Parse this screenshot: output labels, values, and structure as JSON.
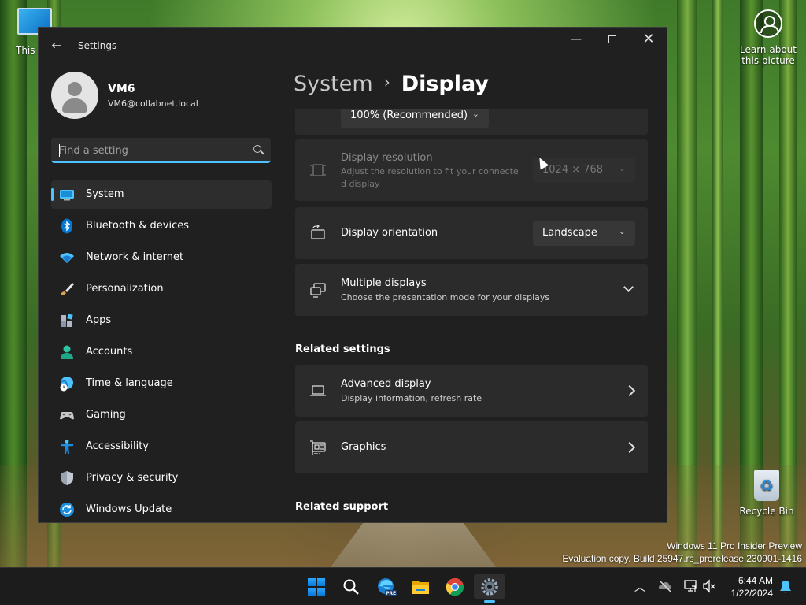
{
  "desktop": {
    "this_pc_label": "This PC",
    "learn_label": "Learn about this picture",
    "recycle_label": "Recycle Bin",
    "watermark_line1": "Windows 11 Pro Insider Preview",
    "watermark_line2": "Evaluation copy. Build 25947.rs_prerelease.230901-1416"
  },
  "window": {
    "title": "Settings",
    "back_glyph": "←",
    "min_glyph": "—",
    "close_glyph": "✕"
  },
  "profile": {
    "name": "VM6",
    "email": "VM6@collabnet.local"
  },
  "search": {
    "placeholder": "Find a setting",
    "value": ""
  },
  "nav": {
    "items": [
      {
        "label": "System",
        "icon": "monitor-icon",
        "active": true
      },
      {
        "label": "Bluetooth & devices",
        "icon": "bluetooth-icon"
      },
      {
        "label": "Network & internet",
        "icon": "wifi-icon"
      },
      {
        "label": "Personalization",
        "icon": "brush-icon"
      },
      {
        "label": "Apps",
        "icon": "apps-icon"
      },
      {
        "label": "Accounts",
        "icon": "person-icon"
      },
      {
        "label": "Time & language",
        "icon": "globe-clock-icon"
      },
      {
        "label": "Gaming",
        "icon": "gamepad-icon"
      },
      {
        "label": "Accessibility",
        "icon": "accessibility-icon"
      },
      {
        "label": "Privacy & security",
        "icon": "shield-icon"
      },
      {
        "label": "Windows Update",
        "icon": "update-icon"
      }
    ]
  },
  "breadcrumb": {
    "parent": "System",
    "separator": "›",
    "current": "Display"
  },
  "content": {
    "scale_value": "100% (Recommended)",
    "resolution": {
      "title": "Display resolution",
      "subtitle": "Adjust the resolution to fit your connecte d display",
      "value": "1024 × 768"
    },
    "orientation": {
      "title": "Display orientation",
      "value": "Landscape"
    },
    "multiple": {
      "title": "Multiple displays",
      "subtitle": "Choose the presentation mode for your displays"
    },
    "related_settings_heading": "Related settings",
    "advanced": {
      "title": "Advanced display",
      "subtitle": "Display information, refresh rate"
    },
    "graphics": {
      "title": "Graphics"
    },
    "related_support_heading": "Related support"
  },
  "taskbar": {
    "apps": [
      "start-icon",
      "search-icon",
      "edge-beta-icon",
      "file-explorer-icon",
      "chrome-icon",
      "settings-icon"
    ],
    "edge_badge": "PRE",
    "time": "6:44 AM",
    "date": "1/22/2024"
  },
  "colors": {
    "accent": "#4cc2ff",
    "window_bg": "#202020",
    "card_bg": "#2b2b2b"
  }
}
